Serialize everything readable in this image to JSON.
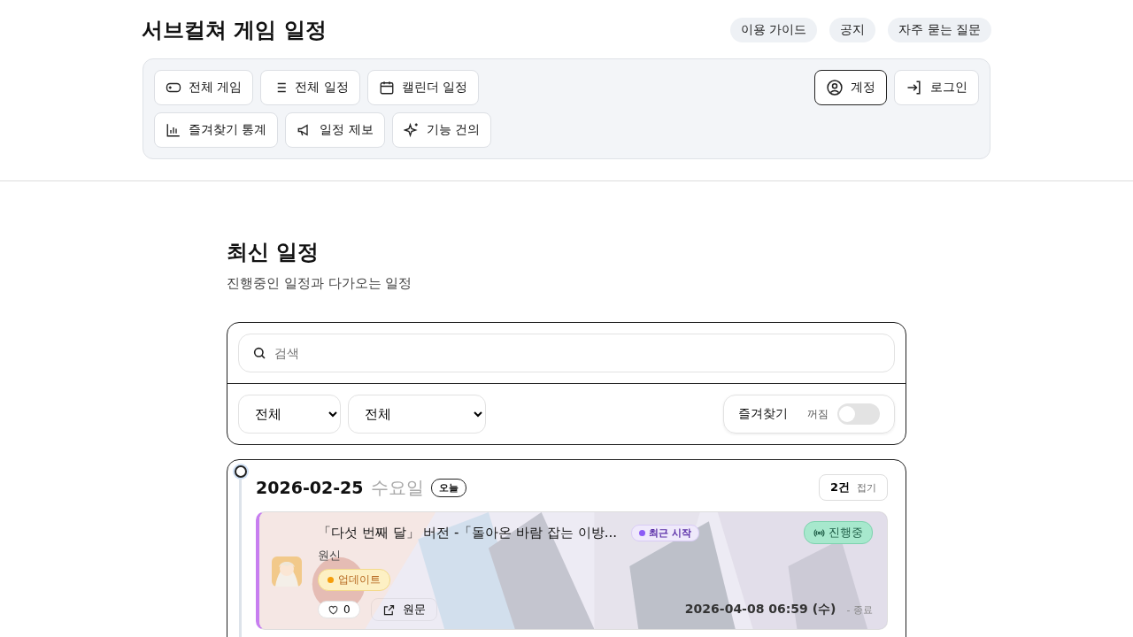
{
  "site_title": "서브컬쳐 게임 일정",
  "header_links": [
    "이용 가이드",
    "공지",
    "자주 묻는 질문"
  ],
  "nav_rows": [
    [
      "전체 게임",
      "전체 일정",
      "캘린더 일정"
    ],
    [
      "즐겨찾기 통계",
      "일정 제보",
      "기능 건의"
    ]
  ],
  "account_buttons": [
    {
      "label": "계정",
      "selected": true
    },
    {
      "label": "로그인",
      "selected": false
    }
  ],
  "section": {
    "title": "최신 일정",
    "subtitle": "진행중인 일정과 다가오는 일정"
  },
  "filters": {
    "search": {
      "placeholder": "검색"
    },
    "selects": [
      "전체",
      "전체"
    ],
    "favorites": {
      "label": "즐겨찾기",
      "state_text": "꺼짐",
      "on": false
    }
  },
  "day": {
    "date": "2026-02-25",
    "weekday": "수요일",
    "today_badge": "오늘",
    "count": "2건",
    "collapse": "접기",
    "events": [
      {
        "kind": "picture",
        "title": "「다섯 번째 달」 버전 -「돌아온 바람 잡는 이방...",
        "recent_badge": "최근 시작",
        "game": "원신",
        "tag": "업데이트",
        "status": "진행중",
        "likes": "0",
        "liked": false,
        "source": "원문",
        "end_time": "2026-04-08 06:59 (수)",
        "end_label": "- 종료"
      }
    ]
  }
}
